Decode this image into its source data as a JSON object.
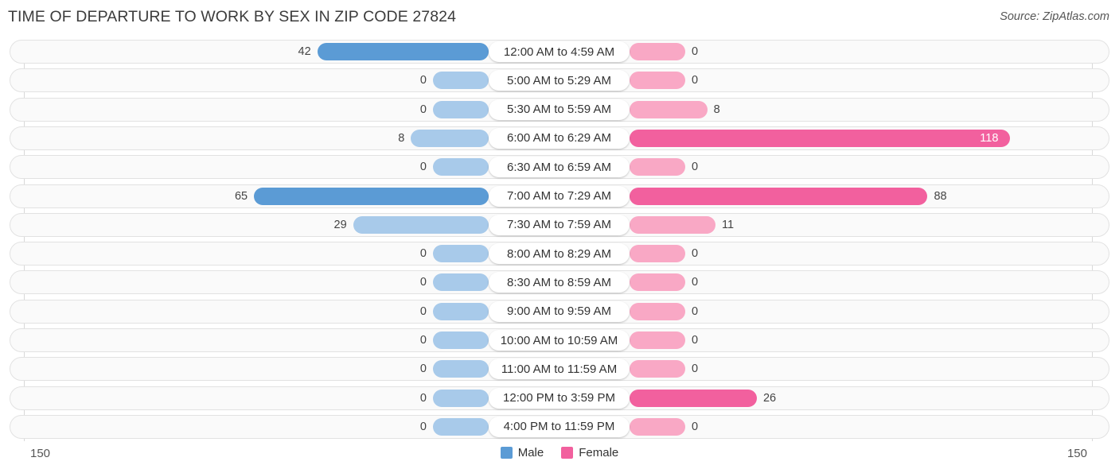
{
  "header": {
    "title": "TIME OF DEPARTURE TO WORK BY SEX IN ZIP CODE 27824",
    "source": "Source: ZipAtlas.com"
  },
  "legend": {
    "male_label": "Male",
    "female_label": "Female",
    "male_color": "#5b9bd5",
    "female_color": "#f2609e"
  },
  "axis": {
    "left_max": "150",
    "right_max": "150"
  },
  "chart_data": {
    "type": "bar",
    "subtype": "diverging-horizontal-bar",
    "title": "TIME OF DEPARTURE TO WORK BY SEX IN ZIP CODE 27824",
    "xlabel": "",
    "ylabel": "",
    "xlim": [
      0,
      150
    ],
    "grid": true,
    "legend_position": "bottom-center",
    "categories": [
      "12:00 AM to 4:59 AM",
      "5:00 AM to 5:29 AM",
      "5:30 AM to 5:59 AM",
      "6:00 AM to 6:29 AM",
      "6:30 AM to 6:59 AM",
      "7:00 AM to 7:29 AM",
      "7:30 AM to 7:59 AM",
      "8:00 AM to 8:29 AM",
      "8:30 AM to 8:59 AM",
      "9:00 AM to 9:59 AM",
      "10:00 AM to 10:59 AM",
      "11:00 AM to 11:59 AM",
      "12:00 PM to 3:59 PM",
      "4:00 PM to 11:59 PM"
    ],
    "series": [
      {
        "name": "Male",
        "color": "#5b9bd5",
        "values": [
          42,
          0,
          0,
          8,
          0,
          65,
          29,
          0,
          0,
          0,
          0,
          0,
          0,
          0
        ]
      },
      {
        "name": "Female",
        "color": "#f2609e",
        "values": [
          0,
          0,
          8,
          118,
          0,
          88,
          11,
          0,
          0,
          0,
          0,
          0,
          26,
          0
        ]
      }
    ]
  },
  "rows": [
    {
      "category": "12:00 AM to 4:59 AM",
      "male": "42",
      "female": "0"
    },
    {
      "category": "5:00 AM to 5:29 AM",
      "male": "0",
      "female": "0"
    },
    {
      "category": "5:30 AM to 5:59 AM",
      "male": "0",
      "female": "8"
    },
    {
      "category": "6:00 AM to 6:29 AM",
      "male": "8",
      "female": "118"
    },
    {
      "category": "6:30 AM to 6:59 AM",
      "male": "0",
      "female": "0"
    },
    {
      "category": "7:00 AM to 7:29 AM",
      "male": "65",
      "female": "88"
    },
    {
      "category": "7:30 AM to 7:59 AM",
      "male": "29",
      "female": "11"
    },
    {
      "category": "8:00 AM to 8:29 AM",
      "male": "0",
      "female": "0"
    },
    {
      "category": "8:30 AM to 8:59 AM",
      "male": "0",
      "female": "0"
    },
    {
      "category": "9:00 AM to 9:59 AM",
      "male": "0",
      "female": "0"
    },
    {
      "category": "10:00 AM to 10:59 AM",
      "male": "0",
      "female": "0"
    },
    {
      "category": "11:00 AM to 11:59 AM",
      "male": "0",
      "female": "0"
    },
    {
      "category": "12:00 PM to 3:59 PM",
      "male": "0",
      "female": "26"
    },
    {
      "category": "4:00 PM to 11:59 PM",
      "male": "0",
      "female": "0"
    }
  ]
}
